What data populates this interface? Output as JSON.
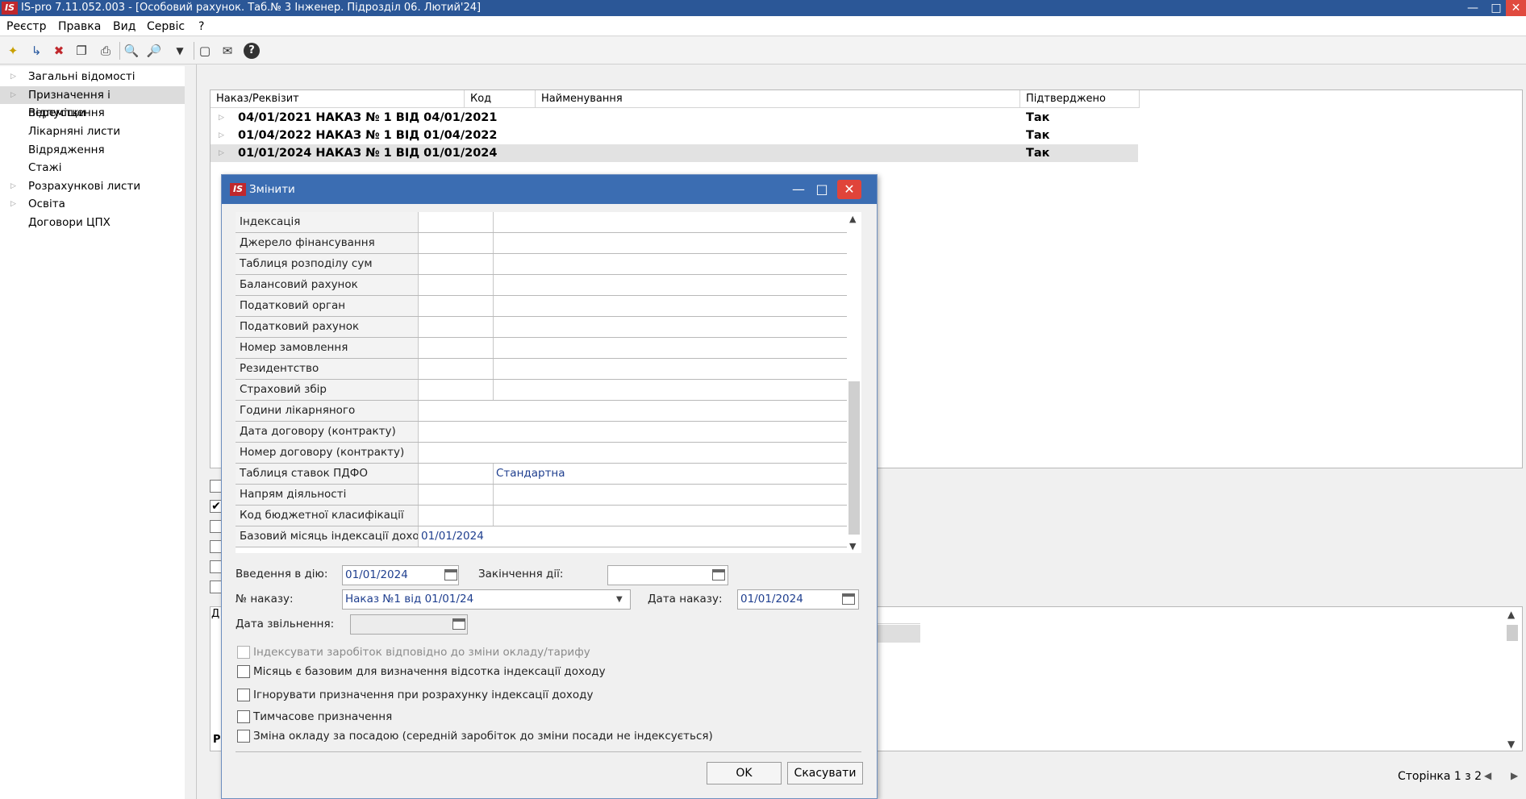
{
  "window": {
    "logo": "IS",
    "title": "IS-pro 7.11.052.003 - [Особовий рахунок. Таб.№ 3 Інженер. Підрозділ 06. Лютий'24]",
    "min_icon": "minimize-icon",
    "max_icon": "maximize-icon",
    "close_icon": "close-icon"
  },
  "menu": [
    "Реєстр",
    "Правка",
    "Вид",
    "Сервіс",
    "?"
  ],
  "toolbar": {
    "icons": [
      "create-icon",
      "create-copy-icon",
      "delete-icon",
      "copy-icon",
      "print-icon",
      "find-icon",
      "find-next-icon",
      "filter-icon",
      "document-icon",
      "mail-icon",
      "help-icon"
    ],
    "glyphs": [
      "✦",
      "↳",
      "✖",
      "❐",
      "⎙",
      "🔍",
      "🔎",
      "▼",
      "▢",
      "✉",
      "?"
    ]
  },
  "left_tree": [
    {
      "label": "Загальні відомості",
      "expandable": true
    },
    {
      "label": "Призначення і переміщення",
      "expandable": true,
      "selected": true
    },
    {
      "label": "Відпустки",
      "expandable": false
    },
    {
      "label": "Лікарняні листи",
      "expandable": false
    },
    {
      "label": "Відрядження",
      "expandable": false
    },
    {
      "label": "Стажі",
      "expandable": false
    },
    {
      "label": "Розрахункові листи",
      "expandable": true
    },
    {
      "label": "Освіта",
      "expandable": true
    },
    {
      "label": "Договори ЦПХ",
      "expandable": false
    }
  ],
  "orders_grid": {
    "columns": [
      "Наказ/Реквізит",
      "Код",
      "Найменування",
      "Підтверджено"
    ],
    "rows": [
      {
        "name": "04/01/2021 НАКАЗ № 1 ВІД 04/01/2021",
        "confirmed": "Так"
      },
      {
        "name": "01/04/2022 НАКАЗ № 1 ВІД 01/04/2022",
        "confirmed": "Так"
      },
      {
        "name": "01/01/2024 НАКАЗ № 1 ВІД 01/01/2024",
        "confirmed": "Так",
        "selected": true
      }
    ]
  },
  "bottom_grid": {
    "cut_header": "Д",
    "cut_footer": "Р"
  },
  "pager": {
    "text": "Сторінка 1 з 2",
    "prev": "◀",
    "next": "▶"
  },
  "dialog": {
    "logo": "IS",
    "title": "Змінити",
    "properties": [
      {
        "name": "Індексація",
        "value": ""
      },
      {
        "name": "Джерело фінансування",
        "value": ""
      },
      {
        "name": "Таблиця розподілу сум",
        "value": ""
      },
      {
        "name": "Балансовий рахунок",
        "value": ""
      },
      {
        "name": "Податковий орган",
        "value": ""
      },
      {
        "name": "Податковий рахунок",
        "value": ""
      },
      {
        "name": "Номер замовлення",
        "value": ""
      },
      {
        "name": "Резидентство",
        "value": ""
      },
      {
        "name": "Страховий збір",
        "value": ""
      },
      {
        "name": "Години лікарняного",
        "value": ""
      },
      {
        "name": "Дата договору (контракту)",
        "value": ""
      },
      {
        "name": "Номер договору (контракту)",
        "value": ""
      },
      {
        "name": "Таблиця ставок ПДФО",
        "value": "Стандартна"
      },
      {
        "name": "Напрям діяльності",
        "value": ""
      },
      {
        "name": "Код бюджетної класифікації",
        "value": ""
      },
      {
        "name": "Базовий місяць індексації доходу",
        "value": "01/01/2024"
      }
    ],
    "fields": {
      "start_label": "Введення в дію:",
      "start_value": "01/01/2024",
      "end_label": "Закінчення дії:",
      "end_value": "",
      "order_no_label": "№ наказу:",
      "order_no_value": "Наказ №1 від 01/01/24",
      "order_date_label": "Дата наказу:",
      "order_date_value": "01/01/2024",
      "dismissal_label": "Дата звільнення:",
      "dismissal_value": ""
    },
    "checkboxes": [
      {
        "label": "Індексувати заробіток відповідно до зміни окладу/тарифу",
        "checked": false,
        "disabled": true
      },
      {
        "label": "Місяць є базовим для визначення відсотка індексації доходу",
        "checked": false,
        "disabled": false
      },
      {
        "label": "Ігнорувати призначення при розрахунку індексації доходу",
        "checked": false,
        "disabled": false
      },
      {
        "label": "Тимчасове призначення",
        "checked": false,
        "disabled": false
      },
      {
        "label": "Зміна окладу за посадою (середній заробіток до зміни посади не індексується)",
        "checked": false,
        "disabled": false
      }
    ],
    "ok_label": "OK",
    "cancel_label": "Скасувати"
  },
  "side_checkboxes": [
    false,
    true,
    false,
    false,
    false,
    false
  ]
}
